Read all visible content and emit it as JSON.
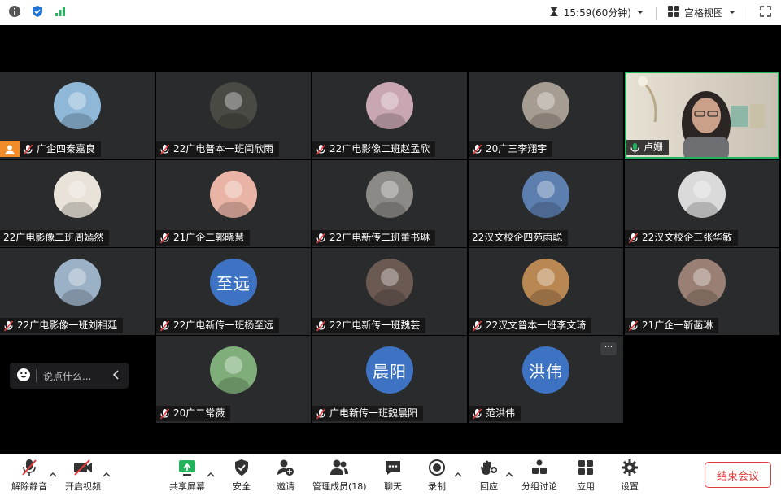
{
  "topbar": {
    "timer": "15:59(60分钟)",
    "view_label": "宫格视图"
  },
  "participants": [
    {
      "name": "广企四秦嘉良",
      "avatar_text": "",
      "avatar_color": "#8fb8d8",
      "muted": true,
      "host": true
    },
    {
      "name": "22广电普本一班闫欣雨",
      "avatar_text": "",
      "avatar_color": "#4a4a44",
      "muted": true
    },
    {
      "name": "22广电影像二班赵孟欣",
      "avatar_text": "",
      "avatar_color": "#c9a7b2",
      "muted": true
    },
    {
      "name": "20广三李翔宇",
      "avatar_text": "",
      "avatar_color": "#a69d92",
      "muted": true
    },
    {
      "name": "卢姗",
      "avatar_text": "",
      "avatar_color": "#d9d3c8",
      "muted": false,
      "video": true
    },
    {
      "name": "22广电影像二班周嫣然",
      "avatar_text": "",
      "avatar_color": "#e8e2d8",
      "muted": false
    },
    {
      "name": "21广企二郭晓慧",
      "avatar_text": "",
      "avatar_color": "#e9b4a5",
      "muted": true
    },
    {
      "name": "22广电新传二班董书琳",
      "avatar_text": "",
      "avatar_color": "#8c8a86",
      "muted": true
    },
    {
      "name": "22汉文校企四苑雨聪",
      "avatar_text": "",
      "avatar_color": "#5d7fb0",
      "muted": false
    },
    {
      "name": "22汉文校企三张华敏",
      "avatar_text": "",
      "avatar_color": "#dadada",
      "muted": true
    },
    {
      "name": "22广电影像一班刘相廷",
      "avatar_text": "",
      "avatar_color": "#9bb1c6",
      "muted": true
    },
    {
      "name": "22广电新传一班杨至远",
      "avatar_text": "至远",
      "avatar_color": "#3e73c4",
      "muted": true
    },
    {
      "name": "22广电新传一班魏芸",
      "avatar_text": "",
      "avatar_color": "#6b5a52",
      "muted": true
    },
    {
      "name": "22汉文普本一班李文琦",
      "avatar_text": "",
      "avatar_color": "#b98752",
      "muted": true
    },
    {
      "name": "21广企一靳菡琳",
      "avatar_text": "",
      "avatar_color": "#9a8074",
      "muted": true
    },
    {
      "name": "20广二常薇",
      "avatar_text": "",
      "avatar_color": "#7fae7a",
      "muted": true
    },
    {
      "name": "广电新传一班魏晨阳",
      "avatar_text": "晨阳",
      "avatar_color": "#3e73c4",
      "muted": true
    },
    {
      "name": "范洪伟",
      "avatar_text": "洪伟",
      "avatar_color": "#3e73c4",
      "muted": true
    }
  ],
  "chat": {
    "placeholder": "说点什么..."
  },
  "more_label": "···",
  "toolbar": {
    "unmute": "解除静音",
    "start_video": "开启视频",
    "share_screen": "共享屏幕",
    "security": "安全",
    "invite": "邀请",
    "participants": "管理成员(18)",
    "chat": "聊天",
    "record": "录制",
    "reactions": "回应",
    "breakout": "分组讨论",
    "apps": "应用",
    "settings": "设置",
    "end_meeting": "结束会议"
  },
  "colors": {
    "accent_green": "#23b35d",
    "avatar_blue": "#3e73c4",
    "host_orange": "#f28c29",
    "end_red": "#e23b3b",
    "muted_red": "#e23b3b"
  }
}
